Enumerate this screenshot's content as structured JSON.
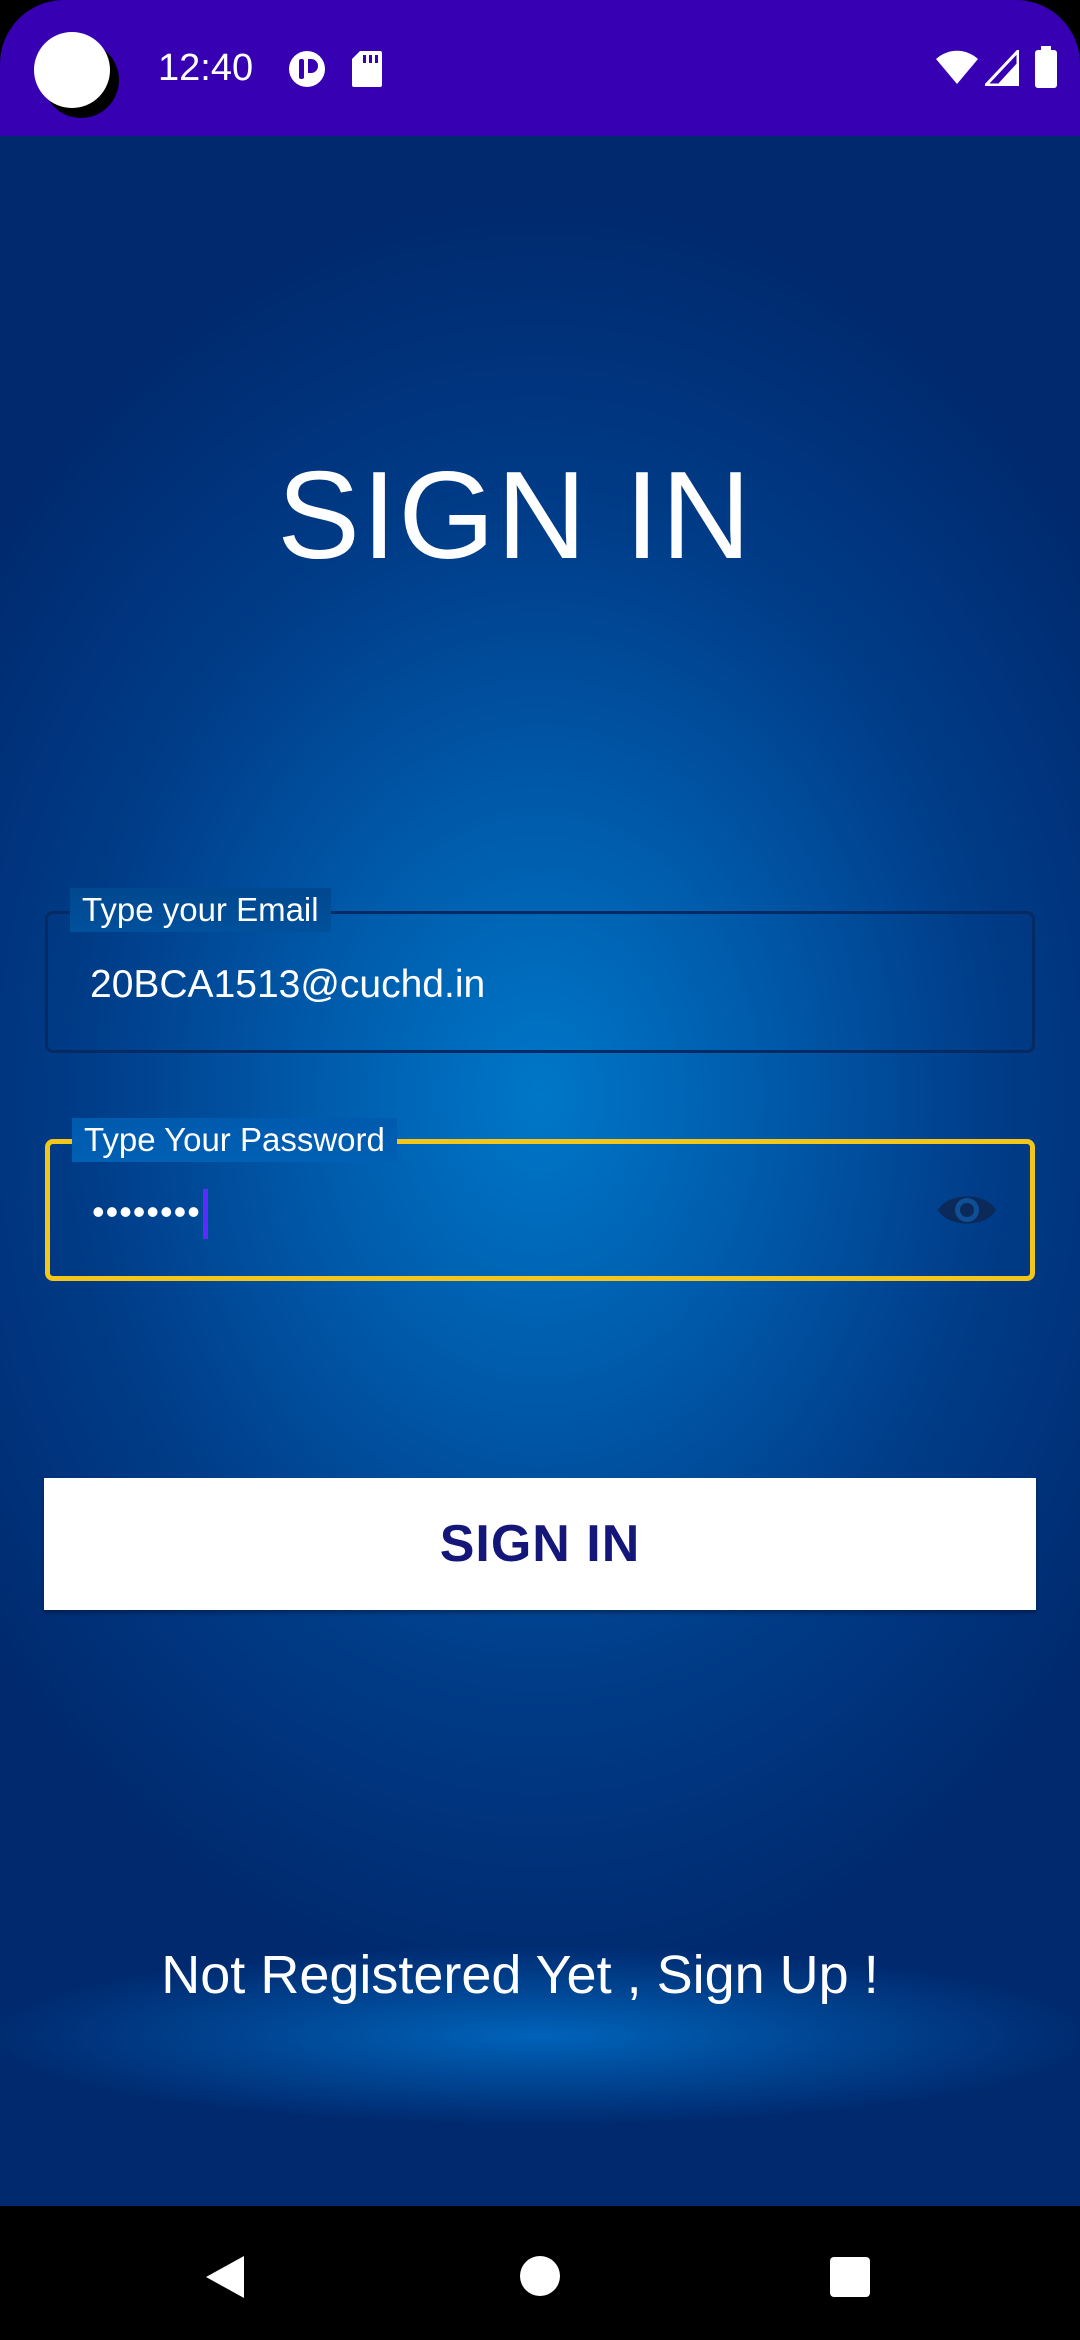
{
  "status_bar": {
    "time": "12:40",
    "icons": [
      "camera-cutout",
      "app-notification-icon",
      "sd-card-icon",
      "wifi-icon",
      "cell-signal-icon",
      "battery-icon"
    ],
    "background_color": "#3700b3"
  },
  "signin": {
    "title": "SIGN IN",
    "email": {
      "label": "Type your Email",
      "value": "20BCA1513@cuchd.in"
    },
    "password": {
      "label": "Type Your Password",
      "value": "••••••••",
      "toggle_icon": "eye-icon"
    },
    "button_label": "SIGN IN",
    "signup_text": "Not Registered Yet , Sign Up !"
  },
  "nav_bar": {
    "icons": [
      "back-icon",
      "home-icon",
      "recents-icon"
    ]
  },
  "colors": {
    "accent": "#f4c61a",
    "button_text": "#14167a",
    "background_center": "#0077c8",
    "background_edge": "#00296e"
  }
}
